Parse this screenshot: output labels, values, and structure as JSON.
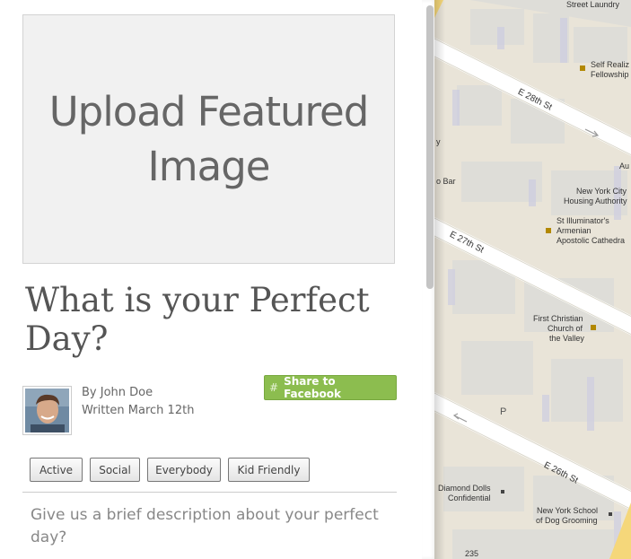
{
  "upload": {
    "label": "Upload Featured Image"
  },
  "post": {
    "title": "What is your Perfect Day?",
    "author": "By John Doe",
    "date": "Written March 12th",
    "share": {
      "icon": "#",
      "label": "Share to Facebook"
    },
    "tags": [
      "Active",
      "Social",
      "Everybody",
      "Kid Friendly"
    ],
    "description_placeholder": "Give us a brief description about your perfect day?"
  },
  "map": {
    "streets": [
      "E 28th St",
      "E 27th St",
      "E 26th St"
    ],
    "places": [
      "Street Laundry",
      "Self Realiz",
      "Fellowship",
      "Au",
      "New York City",
      "Housing Authority",
      "St Illuminator's",
      "Armenian",
      "Apostolic Cathedra",
      "o Bar",
      "y",
      "First Christian",
      "Church of",
      "the Valley",
      "P",
      "Diamond Dolls",
      "Confidential",
      "New York School",
      "of Dog Grooming",
      "235"
    ],
    "colors": {
      "ground": "#e9e4d8",
      "street": "#ffffff",
      "building": "#dedbd5",
      "avenue": "#f5d77a"
    }
  }
}
